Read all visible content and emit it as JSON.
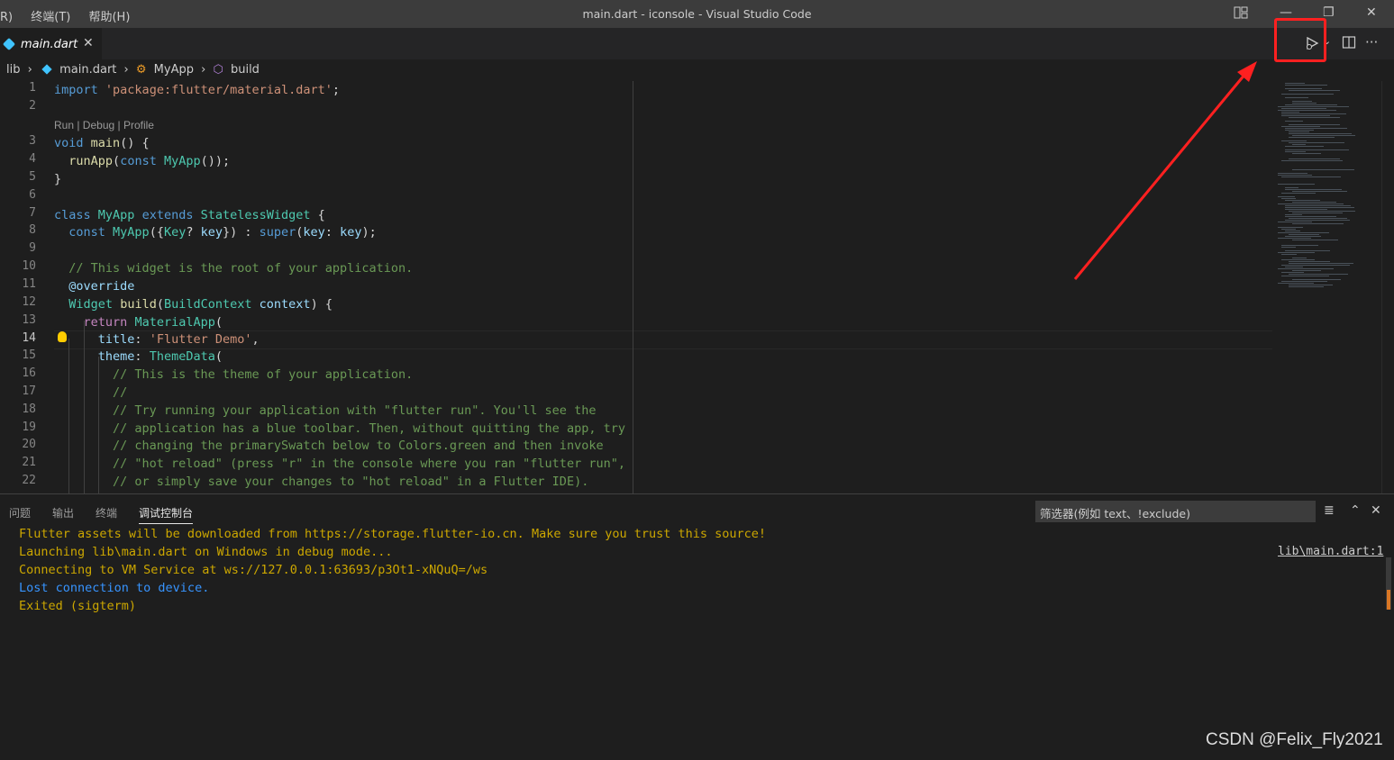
{
  "titlebar": {
    "menu": [
      "R)",
      "终端(T)",
      "帮助(H)"
    ],
    "window_title": "main.dart - iconsole - Visual Studio Code",
    "layout_icon": "layout-icon",
    "min_label": "—",
    "restore_label": "❐",
    "close_label": "✕"
  },
  "tabs": [
    {
      "label": "main.dart",
      "close": "✕",
      "icon": "dart-icon"
    }
  ],
  "tab_actions": {
    "run_debug": "▷",
    "dropdown": "⌄",
    "split": "▥",
    "more": "···"
  },
  "breadcrumb": {
    "folder": "lib",
    "file": "main.dart",
    "class": "MyApp",
    "method": "build",
    "sep": "›"
  },
  "codelens": "Run | Debug | Profile",
  "line_numbers": [
    "1",
    "2",
    "3",
    "4",
    "5",
    "6",
    "7",
    "8",
    "9",
    "10",
    "11",
    "12",
    "13",
    "14",
    "15",
    "16",
    "17",
    "18",
    "19",
    "20",
    "21",
    "22"
  ],
  "active_line": "14",
  "code": {
    "l1": [
      "import",
      " ",
      "'package:flutter/material.dart'",
      ";"
    ],
    "l3": [
      "void",
      " ",
      "main",
      "() {"
    ],
    "l4": [
      "  ",
      "runApp",
      "(",
      "const",
      " ",
      "MyApp",
      "());"
    ],
    "l5": "}",
    "l7": [
      "class",
      " ",
      "MyApp",
      " ",
      "extends",
      " ",
      "StatelessWidget",
      " {"
    ],
    "l8": [
      "  ",
      "const",
      " ",
      "MyApp",
      "({",
      "Key",
      "? ",
      "key",
      "}) : ",
      "super",
      "(",
      "key",
      ": ",
      "key",
      ");"
    ],
    "l10": "  // This widget is the root of your application.",
    "l11": "  @override",
    "l12": [
      "  ",
      "Widget",
      " ",
      "build",
      "(",
      "BuildContext",
      " ",
      "context",
      ") {"
    ],
    "l13": [
      "    ",
      "return",
      " ",
      "MaterialApp",
      "("
    ],
    "l14": [
      "      ",
      "title",
      ": ",
      "'Flutter Demo'",
      ","
    ],
    "l15": [
      "      ",
      "theme",
      ": ",
      "ThemeData",
      "("
    ],
    "l16": "        // This is the theme of your application.",
    "l17": "        //",
    "l18": "        // Try running your application with \"flutter run\". You'll see the",
    "l19": "        // application has a blue toolbar. Then, without quitting the app, try",
    "l20": "        // changing the primarySwatch below to Colors.green and then invoke",
    "l21": "        // \"hot reload\" (press \"r\" in the console where you ran \"flutter run\",",
    "l22": "        // or simply save your changes to \"hot reload\" in a Flutter IDE)."
  },
  "panel": {
    "tabs": [
      "问题",
      "输出",
      "终端",
      "调试控制台"
    ],
    "active_tab": "调试控制台",
    "filter_placeholder": "筛选器(例如 text、!exclude)",
    "output": [
      "Flutter assets will be downloaded from https://storage.flutter-io.cn. Make sure you trust this source!",
      "Launching lib\\main.dart on Windows in debug mode...",
      "Connecting to VM Service at ws://127.0.0.1:63693/p3Ot1-xNQuQ=/ws",
      "Lost connection to device.",
      "Exited (sigterm)"
    ],
    "source_link": "lib\\main.dart:1",
    "icons": {
      "list": "≣",
      "collapse": "⌃",
      "close": "✕"
    }
  },
  "watermark": "CSDN @Felix_Fly2021",
  "colors": {
    "highlight": "#ff2020",
    "keyword": "#569cd6",
    "type": "#4ec9b0",
    "comment": "#6a9955",
    "string": "#ce9178"
  }
}
